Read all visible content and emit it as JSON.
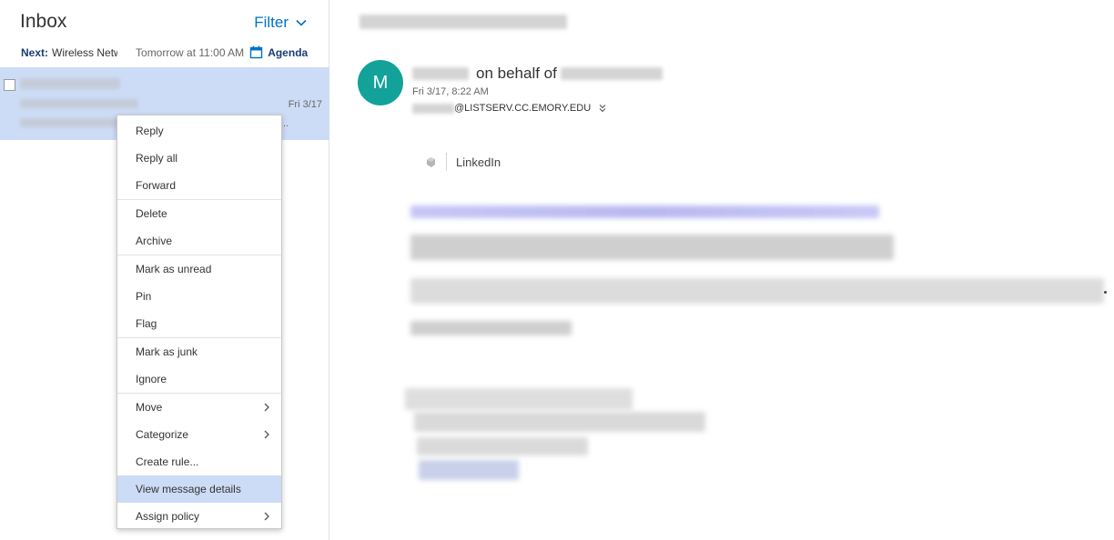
{
  "inbox": {
    "title": "Inbox",
    "filter_label": "Filter",
    "next": {
      "label": "Next:",
      "subject": "Wireless Netw",
      "time": "Tomorrow at 11:00 AM",
      "agenda_label": "Agenda"
    }
  },
  "message_list": [
    {
      "date": "Fri 3/17",
      "ellipsis": "..."
    }
  ],
  "context_menu": {
    "items": [
      {
        "label": "Reply"
      },
      {
        "label": "Reply all"
      },
      {
        "label": "Forward"
      },
      {
        "label": "Delete"
      },
      {
        "label": "Archive"
      },
      {
        "label": "Mark as unread"
      },
      {
        "label": "Pin"
      },
      {
        "label": "Flag"
      },
      {
        "label": "Mark as junk"
      },
      {
        "label": "Ignore"
      },
      {
        "label": "Move",
        "submenu": true
      },
      {
        "label": "Categorize",
        "submenu": true
      },
      {
        "label": "Create rule..."
      },
      {
        "label": "View message details",
        "highlighted": true
      },
      {
        "label": "Assign policy",
        "submenu": true
      }
    ]
  },
  "reading_pane": {
    "avatar_letter": "M",
    "on_behalf_text": "on behalf of",
    "date": "Fri 3/17, 8:22 AM",
    "email_suffix": "@LISTSERV.CC.EMORY.EDU",
    "addin_label": "LinkedIn"
  },
  "colors": {
    "accent": "#0072c6",
    "selected_bg": "#cddcf6",
    "avatar_bg": "#12a29a",
    "next_label": "#1a3e72"
  }
}
